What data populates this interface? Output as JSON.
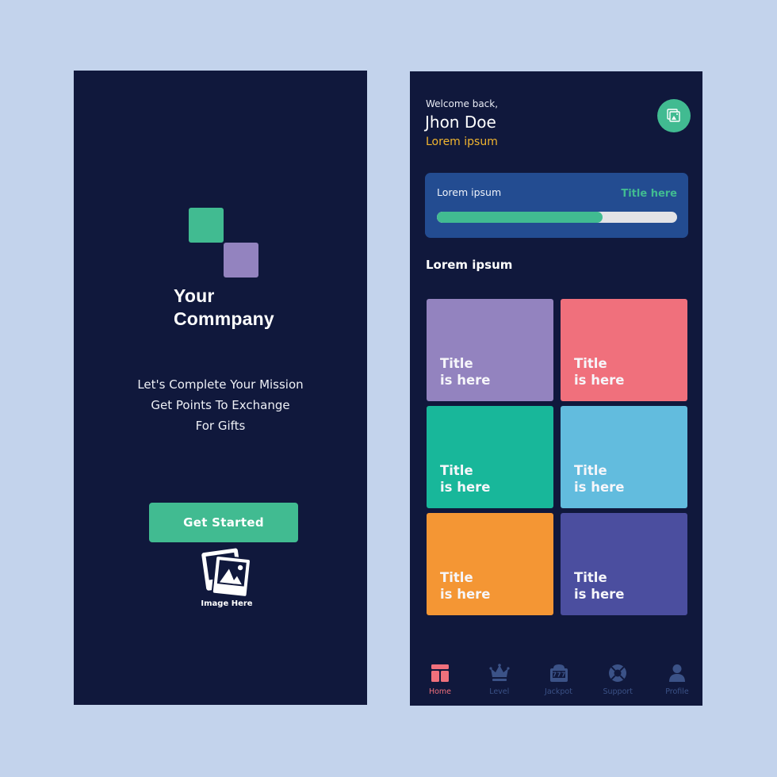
{
  "colors": {
    "page_bg": "#c3d3ec",
    "panel_bg": "#10183c",
    "accent_green": "#41bb91",
    "accent_purple": "#9383bf",
    "accent_yellow": "#f1b52f",
    "card_blue": "#234c91",
    "nav_inactive": "#3b5287",
    "nav_active": "#f0707c"
  },
  "splash": {
    "company_line1": "Your",
    "company_line2": "Commpany",
    "tagline": [
      "Let's Complete Your Mission",
      "Get Points To Exchange",
      "For Gifts"
    ],
    "cta_label": "Get Started",
    "image_placeholder_caption": "Image Here"
  },
  "home": {
    "greeting": "Welcome back,",
    "user_name": "Jhon Doe",
    "user_subtitle": "Lorem ipsum",
    "avatar_icon": "image-placeholder-icon",
    "progress_card": {
      "label": "Lorem ipsum",
      "link": "Title here",
      "progress_percent": 69
    },
    "section_title": "Lorem ipsum",
    "tiles": [
      {
        "line1": "Title",
        "line2": "is here",
        "color": "#9383bf"
      },
      {
        "line1": "Title",
        "line2": "is here",
        "color": "#f0707c"
      },
      {
        "line1": "Title",
        "line2": "is here",
        "color": "#18b79a"
      },
      {
        "line1": "Title",
        "line2": "is here",
        "color": "#62bcde"
      },
      {
        "line1": "Title",
        "line2": "is here",
        "color": "#f49634"
      },
      {
        "line1": "Title",
        "line2": "is here",
        "color": "#4b4e9f"
      }
    ],
    "nav": [
      {
        "label": "Home",
        "icon": "home-layout-icon",
        "active": true
      },
      {
        "label": "Level",
        "icon": "crown-icon",
        "active": false
      },
      {
        "label": "Jackpot",
        "icon": "slot-machine-icon",
        "active": false
      },
      {
        "label": "Support",
        "icon": "lifebuoy-icon",
        "active": false
      },
      {
        "label": "Profile",
        "icon": "user-icon",
        "active": false
      }
    ]
  }
}
